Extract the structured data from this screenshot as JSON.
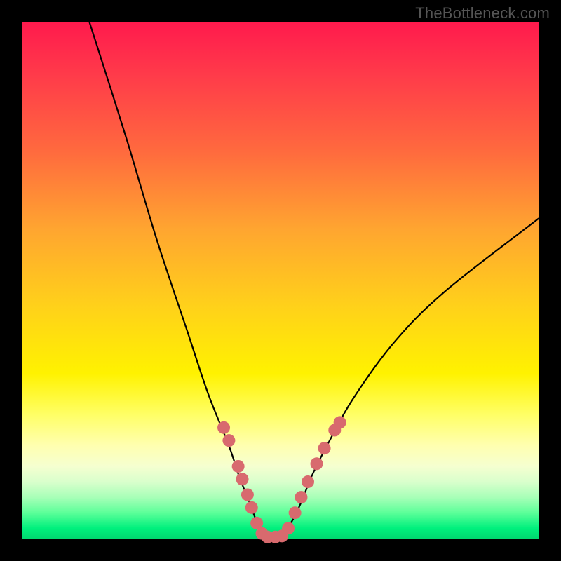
{
  "watermark": "TheBottleneck.com",
  "chart_data": {
    "type": "line",
    "title": "",
    "xlabel": "",
    "ylabel": "",
    "xlim": [
      0,
      100
    ],
    "ylim": [
      0,
      100
    ],
    "grid": false,
    "legend": false,
    "background": "rainbow-gradient",
    "series": [
      {
        "name": "bottleneck-curve",
        "color": "#000000",
        "x": [
          13,
          20,
          26,
          32,
          36,
          40,
          42,
          44,
          45.5,
          47,
          48.5,
          50,
          52,
          54,
          56,
          59,
          64,
          72,
          82,
          100
        ],
        "y": [
          100,
          78,
          58,
          40,
          28,
          18,
          12,
          7,
          3,
          0.5,
          0.5,
          0.5,
          3,
          7,
          12,
          18,
          27,
          38,
          48,
          62
        ]
      }
    ],
    "markers": {
      "name": "highlight-dots",
      "color": "#d86a6e",
      "radius_px": 9,
      "points": [
        {
          "x": 39.0,
          "y": 21.5
        },
        {
          "x": 40.0,
          "y": 19.0
        },
        {
          "x": 41.8,
          "y": 14.0
        },
        {
          "x": 42.6,
          "y": 11.5
        },
        {
          "x": 43.6,
          "y": 8.5
        },
        {
          "x": 44.4,
          "y": 6.0
        },
        {
          "x": 45.4,
          "y": 3.0
        },
        {
          "x": 46.4,
          "y": 1.0
        },
        {
          "x": 47.5,
          "y": 0.3
        },
        {
          "x": 49.0,
          "y": 0.3
        },
        {
          "x": 50.3,
          "y": 0.5
        },
        {
          "x": 51.5,
          "y": 2.0
        },
        {
          "x": 52.8,
          "y": 5.0
        },
        {
          "x": 54.0,
          "y": 8.0
        },
        {
          "x": 55.3,
          "y": 11.0
        },
        {
          "x": 57.0,
          "y": 14.5
        },
        {
          "x": 58.5,
          "y": 17.5
        },
        {
          "x": 60.5,
          "y": 21.0
        },
        {
          "x": 61.5,
          "y": 22.5
        }
      ]
    }
  }
}
